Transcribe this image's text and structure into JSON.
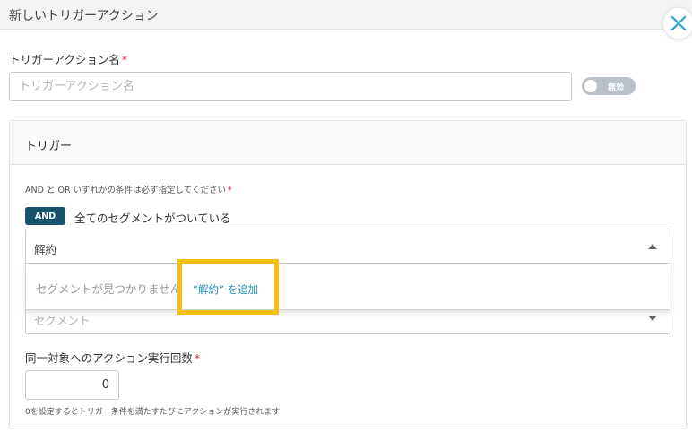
{
  "header": {
    "title": "新しいトリガーアクション"
  },
  "name_field": {
    "label": "トリガーアクション名",
    "required_mark": "*",
    "placeholder": "トリガーアクション名",
    "value": ""
  },
  "toggle": {
    "label": "無効",
    "state": "off"
  },
  "trigger": {
    "title": "トリガー",
    "hint": "AND と OR いずれかの条件は必ず指定してください",
    "required_mark": "*",
    "and_badge": "AND",
    "and_text": "全てのセグメントがついている",
    "search_value": "解約",
    "dropdown": {
      "empty_text": "セグメントが見つかりません",
      "add_text": "“解約” を追加"
    },
    "segment_placeholder": "セグメント"
  },
  "count_field": {
    "label": "同一対象へのアクション実行回数",
    "required_mark": "*",
    "value": "0",
    "hint": "0を設定するとトリガー条件を満たすたびにアクションが実行されます"
  },
  "colors": {
    "and_badge": "#17536b",
    "link": "#1f8fb4",
    "highlight": "#f6be14",
    "required": "#d6213c"
  }
}
